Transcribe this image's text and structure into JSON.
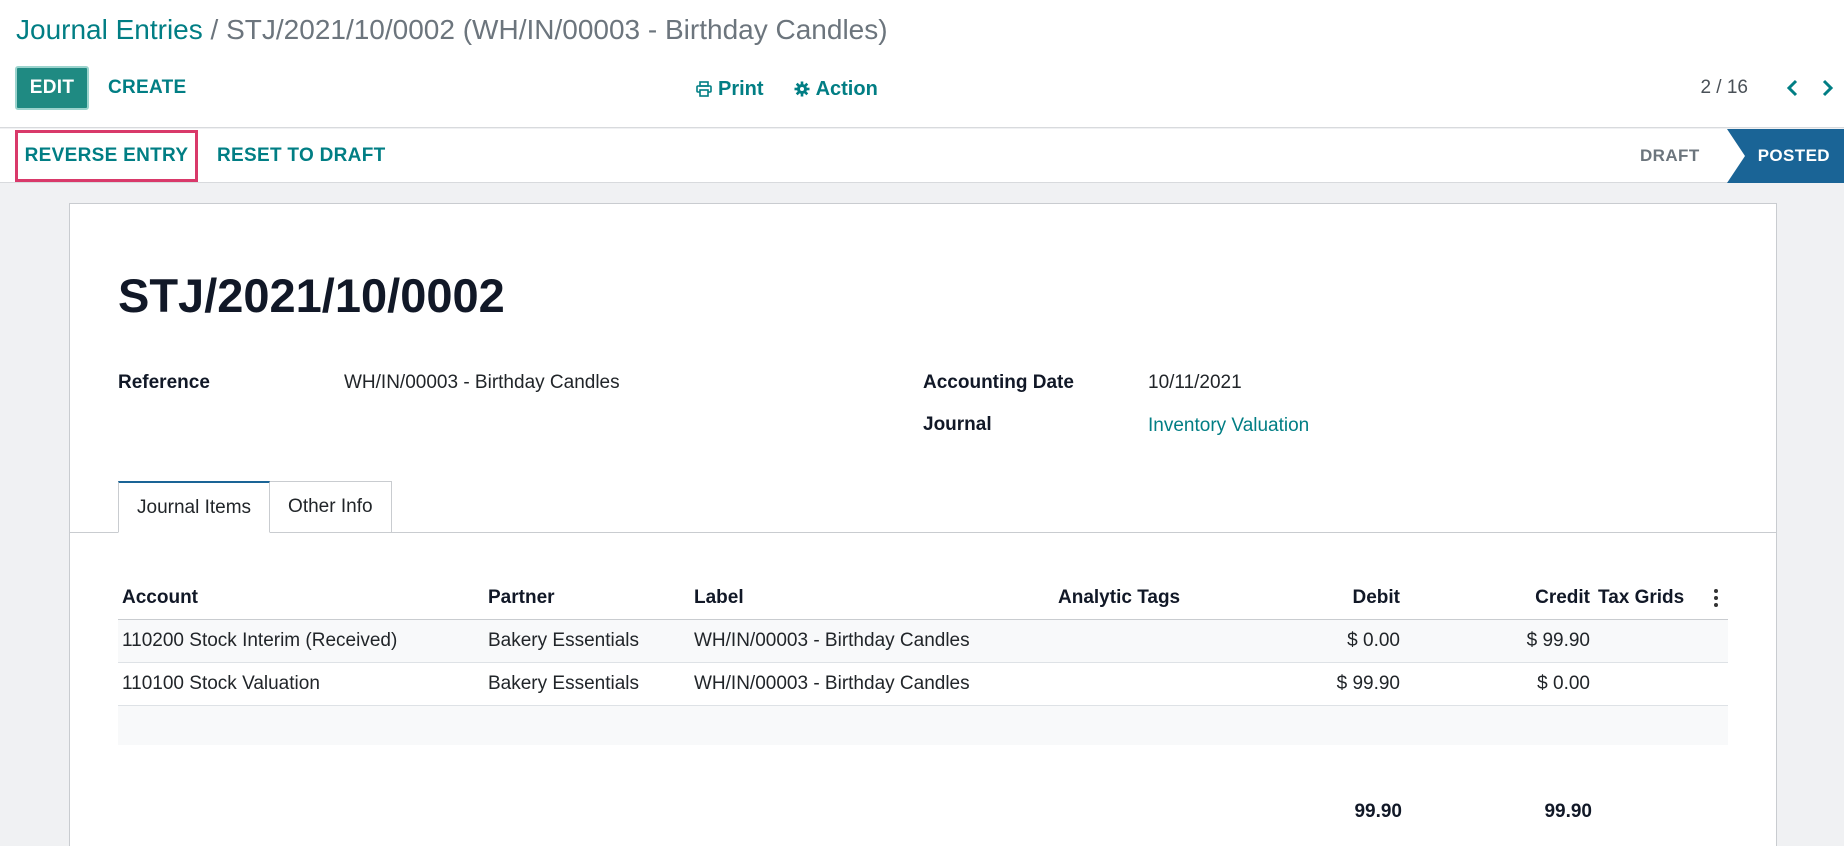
{
  "breadcrumb": {
    "parent": "Journal Entries",
    "separator": "/",
    "current": "STJ/2021/10/0002 (WH/IN/00003 - Birthday Candles)"
  },
  "toolbar": {
    "edit_label": "EDIT",
    "create_label": "CREATE",
    "print_label": "Print",
    "action_label": "Action"
  },
  "pager": {
    "value": "2 / 16"
  },
  "statusbar": {
    "reverse_label": "REVERSE ENTRY",
    "reset_label": "RESET TO DRAFT",
    "states": [
      "DRAFT",
      "POSTED"
    ],
    "active_state": "POSTED"
  },
  "form": {
    "name": "STJ/2021/10/0002",
    "reference_label": "Reference",
    "reference_value": "WH/IN/00003 - Birthday Candles",
    "date_label": "Accounting Date",
    "date_value": "10/11/2021",
    "journal_label": "Journal",
    "journal_value": "Inventory Valuation"
  },
  "tabs": [
    {
      "label": "Journal Items",
      "active": true
    },
    {
      "label": "Other Info",
      "active": false
    }
  ],
  "table": {
    "columns": [
      "Account",
      "Partner",
      "Label",
      "Analytic Tags",
      "Debit",
      "Credit",
      "Tax Grids"
    ],
    "rows": [
      {
        "account": "110200 Stock Interim (Received)",
        "partner": "Bakery Essentials",
        "label": "WH/IN/00003 - Birthday Candles",
        "analytic_tags": "",
        "debit": "$ 0.00",
        "credit": "$ 99.90",
        "tax_grids": ""
      },
      {
        "account": "110100 Stock Valuation",
        "partner": "Bakery Essentials",
        "label": "WH/IN/00003 - Birthday Candles",
        "analytic_tags": "",
        "debit": "$ 99.90",
        "credit": "$ 0.00",
        "tax_grids": ""
      }
    ],
    "total_debit": "99.90",
    "total_credit": "99.90"
  },
  "colors": {
    "accent": "#017e84",
    "primary_button": "#1f8a82",
    "status_active": "#1a6496",
    "highlight_border": "#d9396a"
  }
}
